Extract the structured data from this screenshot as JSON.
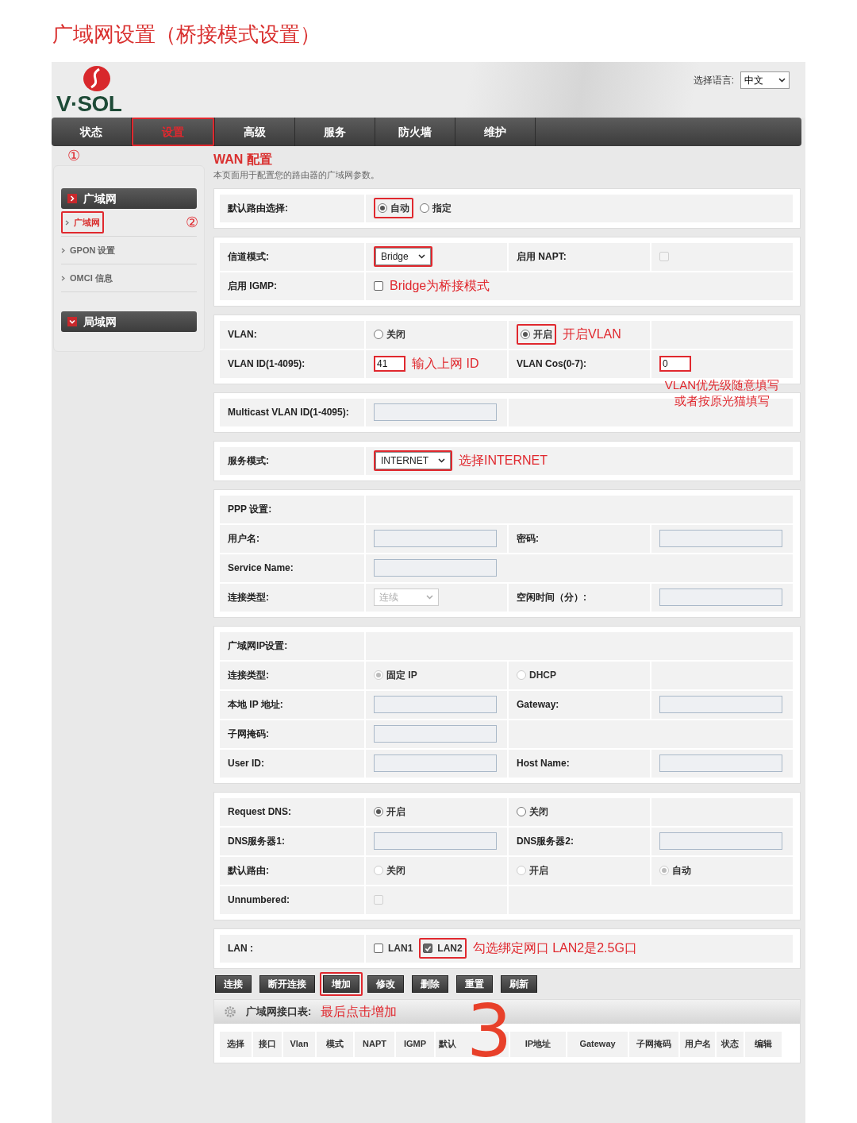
{
  "page_title": "广域网设置（桥接模式设置）",
  "header": {
    "logo": "V·SOL",
    "language_label": "选择语言:",
    "language_value": "中文"
  },
  "nav": [
    {
      "label": "状态",
      "selected": false
    },
    {
      "label": "设置",
      "selected": true,
      "highlighted": true
    },
    {
      "label": "高级",
      "selected": false
    },
    {
      "label": "服务",
      "selected": false
    },
    {
      "label": "防火墙",
      "selected": false
    },
    {
      "label": "维护",
      "selected": false
    }
  ],
  "step_markers": [
    "①",
    "②",
    "3"
  ],
  "sidebar": [
    {
      "label": "广域网",
      "expanded": true,
      "items": [
        {
          "label": "广域网",
          "selected": true,
          "highlighted": true
        },
        {
          "label": "GPON 设置",
          "selected": false
        },
        {
          "label": "OMCI 信息",
          "selected": false
        }
      ]
    },
    {
      "label": "局域网",
      "expanded": false
    }
  ],
  "main": {
    "title": "WAN 配置",
    "description": "本页面用于配置您的路由器的广域网参数。"
  },
  "sections": [
    {
      "rows": [
        {
          "cells": [
            {
              "items": [
                {
                  "kind": "text",
                  "text": "默认路由选择:"
                }
              ]
            },
            {
              "items": [
                {
                  "kind": "radio",
                  "label": "自动",
                  "selected": true,
                  "disabled": false,
                  "highlighted": true
                },
                {
                  "kind": "radio",
                  "label": "指定",
                  "selected": false,
                  "disabled": false
                }
              ]
            }
          ]
        }
      ]
    },
    {
      "rows": [
        {
          "cells": [
            {
              "items": [
                {
                  "kind": "text",
                  "text": "信道模式:"
                }
              ]
            },
            {
              "items": [
                {
                  "kind": "select",
                  "value": "Bridge",
                  "disabled": false,
                  "highlighted": true
                }
              ]
            },
            {
              "items": [
                {
                  "kind": "text",
                  "text": "启用 NAPT:"
                }
              ]
            },
            {
              "items": [
                {
                  "kind": "checkbox",
                  "checked": false,
                  "disabled": true
                }
              ]
            }
          ]
        },
        {
          "cells": [
            {
              "items": [
                {
                  "kind": "text",
                  "text": "启用 IGMP:"
                }
              ]
            },
            {
              "items": [
                {
                  "kind": "checkbox",
                  "checked": false,
                  "disabled": false
                },
                {
                  "kind": "note",
                  "text": "Bridge为桥接模式"
                }
              ]
            }
          ]
        }
      ]
    },
    {
      "rows": [
        {
          "cells": [
            {
              "items": [
                {
                  "kind": "text",
                  "text": "VLAN:"
                }
              ]
            },
            {
              "items": [
                {
                  "kind": "radio",
                  "label": "关闭",
                  "selected": false,
                  "disabled": false
                }
              ]
            },
            {
              "items": [
                {
                  "kind": "radio",
                  "label": "开启",
                  "selected": true,
                  "disabled": false,
                  "highlighted": true
                },
                {
                  "kind": "note",
                  "text": "开启VLAN"
                }
              ]
            },
            {}
          ]
        },
        {
          "cells": [
            {
              "items": [
                {
                  "kind": "text",
                  "text": "VLAN ID(1-4095):"
                }
              ]
            },
            {
              "items": [
                {
                  "kind": "input",
                  "value": "41",
                  "highlighted": true
                },
                {
                  "kind": "note",
                  "text": "输入上网 ID"
                }
              ]
            },
            {
              "items": [
                {
                  "kind": "text",
                  "text": "VLAN Cos(0-7):"
                }
              ]
            },
            {
              "items": [
                {
                  "kind": "input",
                  "value": "0",
                  "highlighted": true
                }
              ]
            }
          ]
        }
      ],
      "note_lines": [
        "VLAN优先级随意填写",
        "或者按原光猫填写"
      ]
    },
    {
      "rows": [
        {
          "cells": [
            {
              "items": [
                {
                  "kind": "text",
                  "text": "Multicast VLAN ID(1-4095):"
                }
              ]
            },
            {
              "items": [
                {
                  "kind": "input"
                }
              ]
            },
            {}
          ]
        }
      ]
    },
    {
      "rows": [
        {
          "cells": [
            {
              "items": [
                {
                  "kind": "text",
                  "text": "服务模式:"
                }
              ]
            },
            {
              "items": [
                {
                  "kind": "select",
                  "value": "INTERNET",
                  "disabled": false,
                  "highlighted": true
                },
                {
                  "kind": "note",
                  "text": "选择INTERNET"
                }
              ]
            }
          ]
        }
      ]
    },
    {
      "rows": [
        {
          "cells": [
            {
              "items": [
                {
                  "kind": "text",
                  "text": "PPP 设置:"
                }
              ]
            },
            {}
          ]
        },
        {
          "cells": [
            {
              "items": [
                {
                  "kind": "text",
                  "text": "用户名:"
                }
              ]
            },
            {
              "items": [
                {
                  "kind": "input"
                }
              ]
            },
            {
              "items": [
                {
                  "kind": "text",
                  "text": "密码:"
                }
              ]
            },
            {
              "items": [
                {
                  "kind": "input"
                }
              ]
            }
          ]
        },
        {
          "cells": [
            {
              "items": [
                {
                  "kind": "text",
                  "text": "Service Name:"
                }
              ]
            },
            {
              "items": [
                {
                  "kind": "input"
                }
              ]
            }
          ]
        },
        {
          "cells": [
            {
              "items": [
                {
                  "kind": "text",
                  "text": "连接类型:"
                }
              ]
            },
            {
              "items": [
                {
                  "kind": "select",
                  "value": "连续",
                  "disabled": true
                }
              ]
            },
            {
              "items": [
                {
                  "kind": "text",
                  "text": "空闲时间（分）:"
                }
              ]
            },
            {
              "items": [
                {
                  "kind": "input"
                }
              ]
            }
          ]
        }
      ]
    },
    {
      "rows": [
        {
          "cells": [
            {
              "items": [
                {
                  "kind": "text",
                  "text": "广域网IP设置:"
                }
              ]
            },
            {}
          ]
        },
        {
          "cells": [
            {
              "items": [
                {
                  "kind": "text",
                  "text": "连接类型:"
                }
              ]
            },
            {
              "items": [
                {
                  "kind": "radio",
                  "label": "固定 IP",
                  "selected": true,
                  "disabled": true
                }
              ]
            },
            {
              "items": [
                {
                  "kind": "radio",
                  "label": "DHCP",
                  "selected": false,
                  "disabled": true
                }
              ]
            },
            {}
          ]
        },
        {
          "cells": [
            {
              "items": [
                {
                  "kind": "text",
                  "text": "本地 IP 地址:"
                }
              ]
            },
            {
              "items": [
                {
                  "kind": "input"
                }
              ]
            },
            {
              "items": [
                {
                  "kind": "text",
                  "text": "Gateway:"
                }
              ]
            },
            {
              "items": [
                {
                  "kind": "input"
                }
              ]
            }
          ]
        },
        {
          "cells": [
            {
              "items": [
                {
                  "kind": "text",
                  "text": "子网掩码:"
                }
              ]
            },
            {
              "items": [
                {
                  "kind": "input"
                }
              ]
            },
            {}
          ]
        },
        {
          "cells": [
            {
              "items": [
                {
                  "kind": "text",
                  "text": "User ID:"
                }
              ]
            },
            {
              "items": [
                {
                  "kind": "input"
                }
              ]
            },
            {
              "items": [
                {
                  "kind": "text",
                  "text": "Host Name:"
                }
              ]
            },
            {
              "items": [
                {
                  "kind": "input"
                }
              ]
            }
          ]
        }
      ]
    },
    {
      "rows": [
        {
          "cells": [
            {
              "items": [
                {
                  "kind": "text",
                  "text": "Request DNS:"
                }
              ]
            },
            {
              "items": [
                {
                  "kind": "radio",
                  "label": "开启",
                  "selected": true,
                  "disabled": false
                }
              ]
            },
            {
              "items": [
                {
                  "kind": "radio",
                  "label": "关闭",
                  "selected": false,
                  "disabled": false
                }
              ]
            },
            {}
          ]
        },
        {
          "cells": [
            {
              "items": [
                {
                  "kind": "text",
                  "text": "DNS服务器1:"
                }
              ]
            },
            {
              "items": [
                {
                  "kind": "input"
                }
              ]
            },
            {
              "items": [
                {
                  "kind": "text",
                  "text": "DNS服务器2:"
                }
              ]
            },
            {
              "items": [
                {
                  "kind": "input"
                }
              ]
            }
          ]
        },
        {
          "cells": [
            {
              "items": [
                {
                  "kind": "text",
                  "text": "默认路由:"
                }
              ]
            },
            {
              "items": [
                {
                  "kind": "radio",
                  "label": "关闭",
                  "selected": false,
                  "disabled": true
                }
              ]
            },
            {
              "items": [
                {
                  "kind": "radio",
                  "label": "开启",
                  "selected": false,
                  "disabled": true
                }
              ]
            },
            {
              "items": [
                {
                  "kind": "radio",
                  "label": "自动",
                  "selected": true,
                  "disabled": true
                }
              ]
            }
          ]
        },
        {
          "cells": [
            {
              "items": [
                {
                  "kind": "text",
                  "text": "Unnumbered:"
                }
              ]
            },
            {
              "items": [
                {
                  "kind": "checkbox",
                  "checked": false,
                  "disabled": true
                }
              ]
            },
            {}
          ]
        }
      ]
    },
    {
      "rows": [
        {
          "cells": [
            {
              "items": [
                {
                  "kind": "text",
                  "text": "LAN :"
                }
              ]
            },
            {
              "items": [
                {
                  "kind": "checkbox",
                  "label": "LAN1",
                  "checked": false,
                  "disabled": false
                },
                {
                  "kind": "checkbox",
                  "label": "LAN2",
                  "checked": true,
                  "disabled": false,
                  "highlighted": true
                },
                {
                  "kind": "note",
                  "text": "勾选绑定网口 LAN2是2.5G口"
                }
              ]
            }
          ]
        }
      ]
    }
  ],
  "buttons": [
    {
      "label": "连接"
    },
    {
      "label": "断开连接"
    },
    {
      "label": "增加",
      "highlighted": true
    },
    {
      "label": "修改"
    },
    {
      "label": "删除"
    },
    {
      "label": "重置"
    },
    {
      "label": "刷新"
    }
  ],
  "interface_table": {
    "title": "广域网接口表:",
    "note": "最后点击增加",
    "columns": [
      "选择",
      "接口",
      "Vlan",
      "模式",
      "NAPT",
      "IGMP",
      "默认",
      "IP地址",
      "Gateway",
      "子网掩码",
      "用户名",
      "状态",
      "编辑"
    ]
  }
}
